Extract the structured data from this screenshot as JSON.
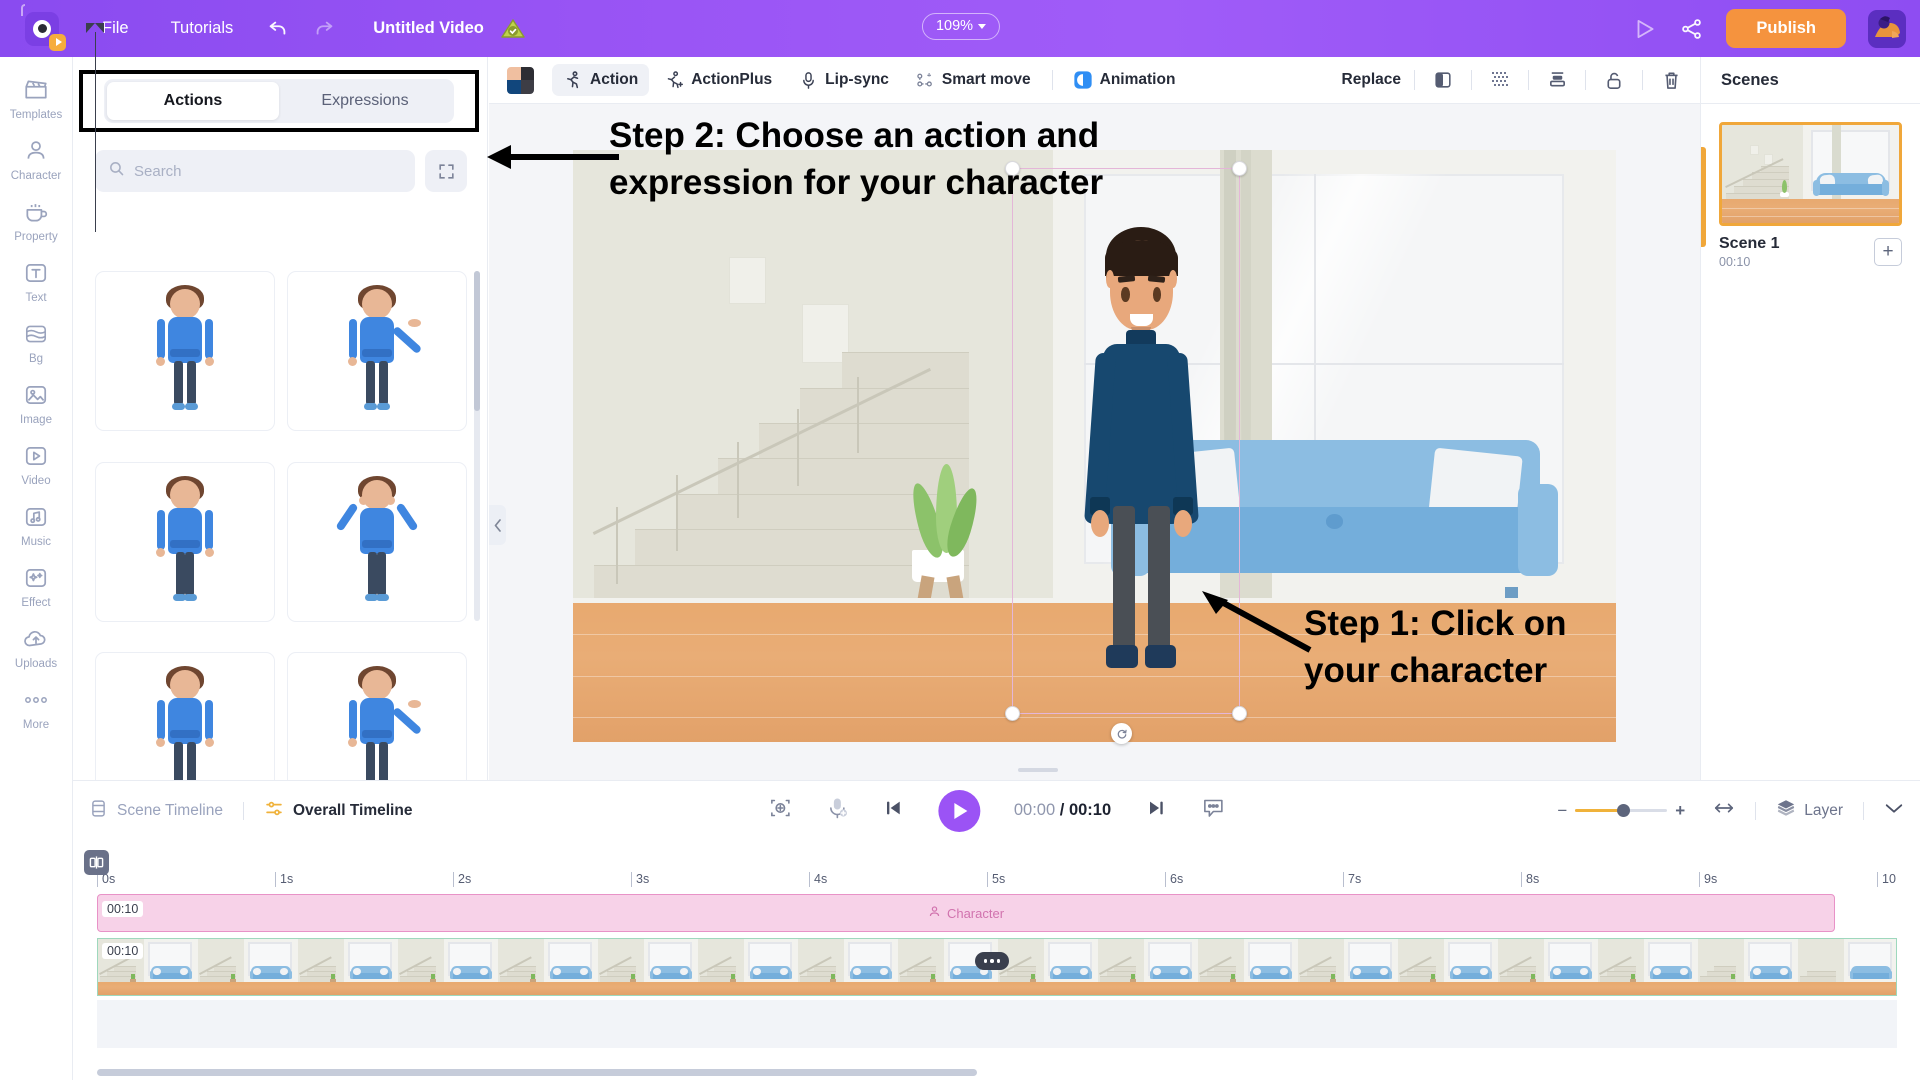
{
  "app": {
    "logo_name": "animaker-logo",
    "menu": [
      {
        "label": "File",
        "name": "menu-file"
      },
      {
        "label": "Tutorials",
        "name": "menu-tutorials"
      }
    ],
    "undo_icon": "undo-icon",
    "redo_icon": "redo-icon",
    "doc_title": "Untitled Video",
    "save_status_icon": "cloud-saved-icon",
    "zoom_level": "109%",
    "preview_icon": "play-preview-icon",
    "share_icon": "share-icon",
    "publish_label": "Publish",
    "avatar_name": "user-avatar",
    "accent_purple": "#9b53f5",
    "accent_orange": "#f5933e"
  },
  "rail": {
    "items": [
      {
        "label": "Templates",
        "icon": "templates-icon"
      },
      {
        "label": "Character",
        "icon": "character-icon"
      },
      {
        "label": "Property",
        "icon": "property-icon"
      },
      {
        "label": "Text",
        "icon": "text-icon"
      },
      {
        "label": "Bg",
        "icon": "bg-icon"
      },
      {
        "label": "Image",
        "icon": "image-icon"
      },
      {
        "label": "Video",
        "icon": "video-icon"
      },
      {
        "label": "Music",
        "icon": "music-icon"
      },
      {
        "label": "Effect",
        "icon": "effect-icon"
      },
      {
        "label": "Uploads",
        "icon": "uploads-icon"
      },
      {
        "label": "More",
        "icon": "more-icon"
      }
    ]
  },
  "panel": {
    "tabs": [
      {
        "label": "Actions",
        "active": true
      },
      {
        "label": "Expressions",
        "active": false
      }
    ],
    "search_placeholder": "Search",
    "search_value": "",
    "expand_icon": "expand-icon",
    "items": [
      {
        "name": "action-standing-idle",
        "pose": "idle"
      },
      {
        "name": "action-presenting-right",
        "pose": "present"
      },
      {
        "name": "action-standing-sad",
        "pose": "sad"
      },
      {
        "name": "action-head-in-hands",
        "pose": "worried"
      },
      {
        "name": "action-standing-idle-2",
        "pose": "idle"
      },
      {
        "name": "action-presenting-right-2",
        "pose": "present"
      }
    ],
    "collapse_icon": "chevron-left-icon"
  },
  "canvas_toolbar": {
    "color_swatch_name": "color-swatch",
    "tools": [
      {
        "label": "Action",
        "icon": "action-walk-icon",
        "active": true
      },
      {
        "label": "ActionPlus",
        "icon": "action-plus-icon",
        "active": false
      },
      {
        "label": "Lip-sync",
        "icon": "microphone-icon",
        "active": false
      },
      {
        "label": "Smart move",
        "icon": "smart-move-icon",
        "active": false
      },
      {
        "label": "Animation",
        "icon": "animation-icon",
        "active": false
      }
    ],
    "replace_label": "Replace",
    "right_icons": [
      {
        "name": "flip-horizontal-icon"
      },
      {
        "name": "opacity-icon"
      },
      {
        "name": "align-icon"
      },
      {
        "name": "unlock-icon"
      },
      {
        "name": "delete-icon"
      }
    ]
  },
  "canvas": {
    "selection": {
      "rotate_icon": "rotate-icon",
      "handle_count": 4
    },
    "annotations": [
      {
        "id": "step2",
        "line1": "Step 2: Choose an action and",
        "line2": "expression for your character"
      },
      {
        "id": "step1",
        "line1": "Step 1: Click on",
        "line2": "your character"
      }
    ]
  },
  "scenes": {
    "header": "Scenes",
    "list": [
      {
        "name": "Scene 1",
        "duration": "00:10",
        "active": true
      }
    ],
    "add_label": "+"
  },
  "timeline": {
    "modes": [
      {
        "label": "Scene Timeline",
        "icon": "scene-timeline-icon",
        "active": false
      },
      {
        "label": "Overall Timeline",
        "icon": "overall-timeline-icon",
        "active": true
      }
    ],
    "controls": [
      {
        "name": "fit-to-screen-button",
        "icon": "fit-icon"
      },
      {
        "name": "voice-record-button",
        "icon": "microphone-add-icon"
      },
      {
        "name": "prev-frame-button",
        "icon": "skip-back-icon"
      },
      {
        "name": "play-button",
        "icon": "play-icon"
      },
      {
        "name": "next-frame-button",
        "icon": "skip-forward-icon"
      },
      {
        "name": "subtitle-button",
        "icon": "subtitle-icon"
      }
    ],
    "current_time": "00:00",
    "separator": "/",
    "total_time": "00:10",
    "zoom_minus": "−",
    "zoom_plus": "+",
    "fit_icon": "fit-width-icon",
    "layer_label": "Layer",
    "layer_icon": "layers-icon",
    "collapse_icon": "chevron-down-icon",
    "split_icon": "split-icon",
    "ruler_ticks": [
      "0s",
      "1s",
      "2s",
      "3s",
      "4s",
      "5s",
      "6s",
      "7s",
      "8s",
      "9s",
      "10"
    ],
    "tracks": [
      {
        "type": "character",
        "badge": "00:10",
        "label": "Character",
        "icon": "person-icon"
      },
      {
        "type": "scene",
        "badge": "00:10",
        "label": ""
      }
    ],
    "more_chip_icon": "more-dots-icon"
  }
}
